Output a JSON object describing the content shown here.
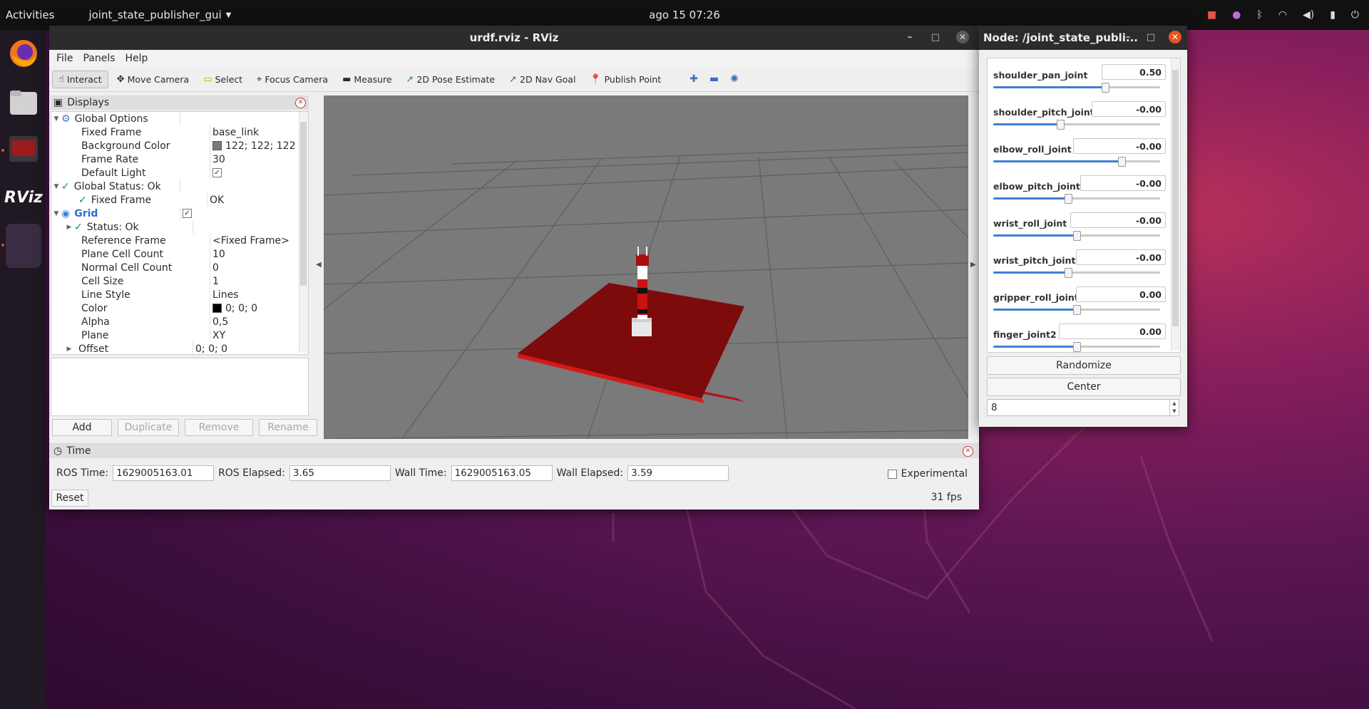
{
  "topbar": {
    "activities": "Activities",
    "app_menu": "joint_state_publisher_gui",
    "clock": "ago 15  07:26"
  },
  "dock": {
    "items": [
      "firefox-icon",
      "files-icon",
      "terminal-icon",
      "rviz-icon",
      "show-apps-icon"
    ],
    "rviz_label": "RViz"
  },
  "rviz": {
    "title": "urdf.rviz - RViz",
    "menu": [
      "File",
      "Panels",
      "Help"
    ],
    "toolbar": [
      "Interact",
      "Move Camera",
      "Select",
      "Focus Camera",
      "Measure",
      "2D Pose Estimate",
      "2D Nav Goal",
      "Publish Point"
    ],
    "displays": {
      "title": "Displays",
      "rows": [
        {
          "name": "Global Options",
          "value": ""
        },
        {
          "name": "Fixed Frame",
          "value": "base_link"
        },
        {
          "name": "Background Color",
          "value": "122; 122; 122"
        },
        {
          "name": "Frame Rate",
          "value": "30"
        },
        {
          "name": "Default Light",
          "value": ""
        },
        {
          "name": "Global Status: Ok",
          "value": ""
        },
        {
          "name": "Fixed Frame",
          "value": "OK"
        },
        {
          "name": "Grid",
          "value": ""
        },
        {
          "name": "Status: Ok",
          "value": ""
        },
        {
          "name": "Reference Frame",
          "value": "<Fixed Frame>"
        },
        {
          "name": "Plane Cell Count",
          "value": "10"
        },
        {
          "name": "Normal Cell Count",
          "value": "0"
        },
        {
          "name": "Cell Size",
          "value": "1"
        },
        {
          "name": "Line Style",
          "value": "Lines"
        },
        {
          "name": "Color",
          "value": "0; 0; 0"
        },
        {
          "name": "Alpha",
          "value": "0,5"
        },
        {
          "name": "Plane",
          "value": "XY"
        },
        {
          "name": "Offset",
          "value": "0; 0; 0"
        }
      ],
      "buttons": {
        "add": "Add",
        "duplicate": "Duplicate",
        "remove": "Remove",
        "rename": "Rename"
      }
    },
    "time": {
      "title": "Time",
      "ros_time_label": "ROS Time:",
      "ros_time": "1629005163.01",
      "ros_elapsed_label": "ROS Elapsed:",
      "ros_elapsed": "3.65",
      "wall_time_label": "Wall Time:",
      "wall_time": "1629005163.05",
      "wall_elapsed_label": "Wall Elapsed:",
      "wall_elapsed": "3.59",
      "experimental": "Experimental",
      "reset": "Reset",
      "fps": "31 fps"
    }
  },
  "jsp": {
    "title": "Node: /joint_state_publi...",
    "joints": [
      {
        "name": "shoulder_pan_joint",
        "value": "0.50",
        "slider": 0.67
      },
      {
        "name": "shoulder_pitch_joint",
        "value": "-0.00",
        "slider": 0.4
      },
      {
        "name": "elbow_roll_joint",
        "value": "-0.00",
        "slider": 0.77
      },
      {
        "name": "elbow_pitch_joint",
        "value": "-0.00",
        "slider": 0.45
      },
      {
        "name": "wrist_roll_joint",
        "value": "-0.00",
        "slider": 0.5
      },
      {
        "name": "wrist_pitch_joint",
        "value": "-0.00",
        "slider": 0.45
      },
      {
        "name": "gripper_roll_joint",
        "value": "0.00",
        "slider": 0.5
      },
      {
        "name": "finger_joint2",
        "value": "0.00",
        "slider": 0.5
      }
    ],
    "randomize": "Randomize",
    "center": "Center",
    "spin_value": "8"
  },
  "colors": {
    "robot_red": "#8b0000",
    "grid_bg": "#7a7a7a",
    "accent_blue": "#3d7fd6"
  }
}
